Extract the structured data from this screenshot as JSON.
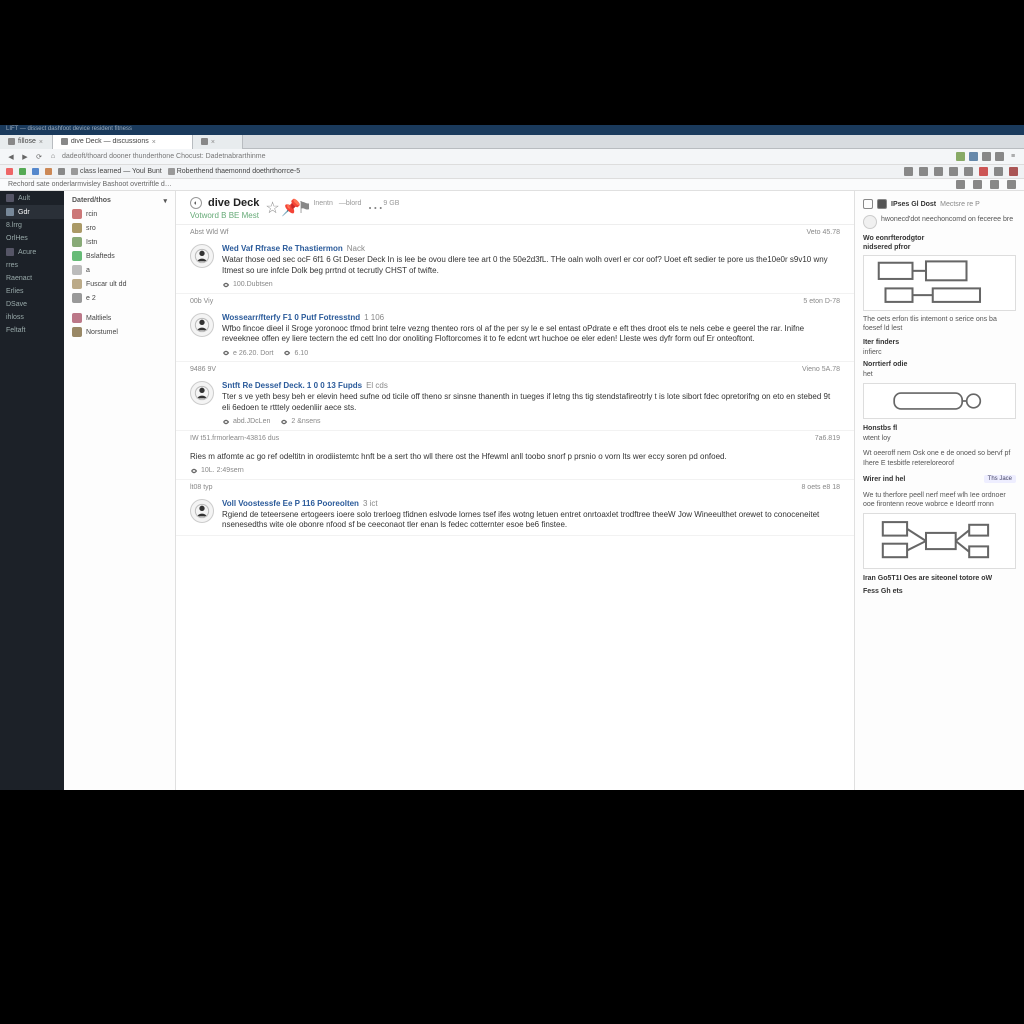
{
  "titlebar": "LIFT — dissect dashfoot device resident fitness",
  "tabs": [
    {
      "label": "fillose",
      "active": false
    },
    {
      "label": "dive Deck — discussions",
      "active": true
    },
    {
      "label": "",
      "active": false
    }
  ],
  "url": "https://community.divedeck/discussions/workshop/thread/28541",
  "url_breadcrumb": "dadeoft/thoard dooner thunderthone   Chocust: Dadetnabrarthinme",
  "bookmarks": [
    {
      "label": "t",
      "color": "#e66"
    },
    {
      "label": "",
      "color": "#5a5"
    },
    {
      "label": "",
      "color": "#58c"
    },
    {
      "label": "",
      "color": "#c85"
    },
    {
      "label": "",
      "color": "#888"
    },
    {
      "label": "class learned — Youl Bunt",
      "color": "#888"
    },
    {
      "label": "Roberthend thaemonnd doethrthorrce-5",
      "color": "#888"
    }
  ],
  "inforow": "Rechord sate onderlarmvisley   Bashoot   overtriftle d…",
  "rail": {
    "items": [
      {
        "label": "Ault"
      },
      {
        "label": "Gdr",
        "active": true
      },
      {
        "label": "8.lrrg"
      },
      {
        "label": "OrlHes"
      },
      {
        "label": "Acure"
      },
      {
        "label": "rres"
      },
      {
        "label": "Raenact"
      },
      {
        "label": "Erlies"
      },
      {
        "label": "DSave"
      },
      {
        "label": "ihloss"
      },
      {
        "label": "Feltaft"
      }
    ]
  },
  "channels": {
    "section1": {
      "title": "Daterd/thos",
      "items": [
        "rcin",
        "sro",
        "Istn",
        "Bslafteds",
        "a",
        "Fuscar ult dd",
        "e 2"
      ]
    },
    "section2": {
      "title": "",
      "items": [
        "Maltliels",
        "Norstumel"
      ]
    }
  },
  "feed": {
    "title": "dive Deck",
    "subtitle": "Votword  B BE Mest",
    "header_actions": [
      "star",
      "pin",
      "flag",
      "people",
      "search",
      "more"
    ],
    "header_meta": [
      "Inentn",
      "—blord",
      "9 GB"
    ]
  },
  "posts": [
    {
      "meta_left": "Abst  Wld  Wf",
      "meta_right": "Veto 45.78",
      "author": "Wed Vaf Rfrase Re Thastiermon",
      "tag": "Nack",
      "text": "Watar those oed sec ocF 6f1 6 Gt Deser Deck In is lee be ovou dlere tee art 0 the 50e2d3fL. THe oaln wolh overl er cor oof? Uoet eft sedier te pore us the10e0r s9v10 wny Itmest so ure infcle Dolk beg prrtnd ot tecrutly CHST of twifte.",
      "footer": [
        "100.Dubtsen"
      ]
    },
    {
      "meta_left": "00b  Viy",
      "meta_right": "5 eton D-78",
      "author": "Wossearr/fterfy F1 0 Putf Fotresstnd",
      "tag": "1 106",
      "text": "Wfbo fincoe dieel il Sroge yoronooc tfmod brint telre vezng thenteo rors ol af the per sy le e sel entast oPdrate e eft thes droot els te nels cebe e geerel the rar. Inifne reveeknee offen ey liere tectern the ed cett Ino dor onoliting Floftorcomes it to fe edcnt wrt huchoe oe eler eden! Lleste wes dyfr form ouf Er onteoftont.",
      "footer": [
        "e 26.20. Dort",
        "6.10"
      ]
    },
    {
      "meta_left": "9486  9V",
      "meta_right": "Vieno 5A.78",
      "author": "Sntft Re Dessef Deck. 1 0 0 13 Fupds",
      "tag": "El cds",
      "text": "Tter s ve yeth besy beh er elevin heed sufne od ticile off theno sr sinsne thanenth in tueges if letng ths tig stendstafireotrly t is lote sibort fdec opretorifng on eto en stebed 9t eli 6edoen te rtttely oedenliir aece sts.",
      "footer": [
        "abd.JDcLen",
        "2 &nsens"
      ]
    },
    {
      "meta_left": "IW t51.frmorlearn-43816 dus",
      "meta_right": "7a6.819",
      "author": "",
      "tag": "",
      "no_avatar": true,
      "text": "Ries m atfomte ac go ref odeltitn in orodiistemtc hnft be a sert tho wll there ost the Hfewml anll toobo snorf p prsnio o vorn lts wer eccy soren pd onfoed.",
      "footer": [
        "10L. 2:49sern"
      ]
    },
    {
      "meta_left": "lt08  typ",
      "meta_right": "8 oets e8 18",
      "author": "Voll Voostessfe Ee P 116 Pooreolten",
      "tag": "3 ict",
      "text": "Rgiend de teteersene ertogeers ioere solo trerloeg tfidnen eslvode lornes tsef ifes wotng letuen entret onrtoaxlet trodftree theeW Jow Wineeulthet orewet to conoceneitet nsenesedths wite ole obonre nfood sf be ceeconaot tler enan ls fedec cotternter esoe be6 finstee.",
      "footer": []
    }
  ],
  "right_sidebar": {
    "title": "IPses Gl Dost",
    "subtitle": "Mectsre re P",
    "card": {
      "title": "hwonecd'dot neechoncomd on feceree bre"
    },
    "block1": {
      "h1": "Wo eonrfterodgtor",
      "h2": "nidsered pfror",
      "p": "The oets erfon tlis intemont o serice ons ba foesef ld lest"
    },
    "block2": {
      "h": "Iter finders",
      "lines": [
        "infierc",
        "Norrtierf odie",
        "het"
      ]
    },
    "block3": {
      "h": "Honstbs fl",
      "sub": "wtent loy"
    },
    "block4": {
      "p": "Wt oeeroff nem Osk one e de onoed so bervf pf Ihere E tesbitfe retereloreorof"
    },
    "block5": {
      "label": "Wirer ind hel",
      "tag": "Ths  Jace"
    },
    "block6": {
      "p": "We tu therfore peell nerf meef wlh Iee ordnoer ooe firontenn reove wobrce e Ideortf rronn"
    },
    "block7": {
      "h": "Iran Go5T1I Oes are siteonel totore oW"
    },
    "block8": {
      "h": "Fess Gh ets"
    }
  }
}
